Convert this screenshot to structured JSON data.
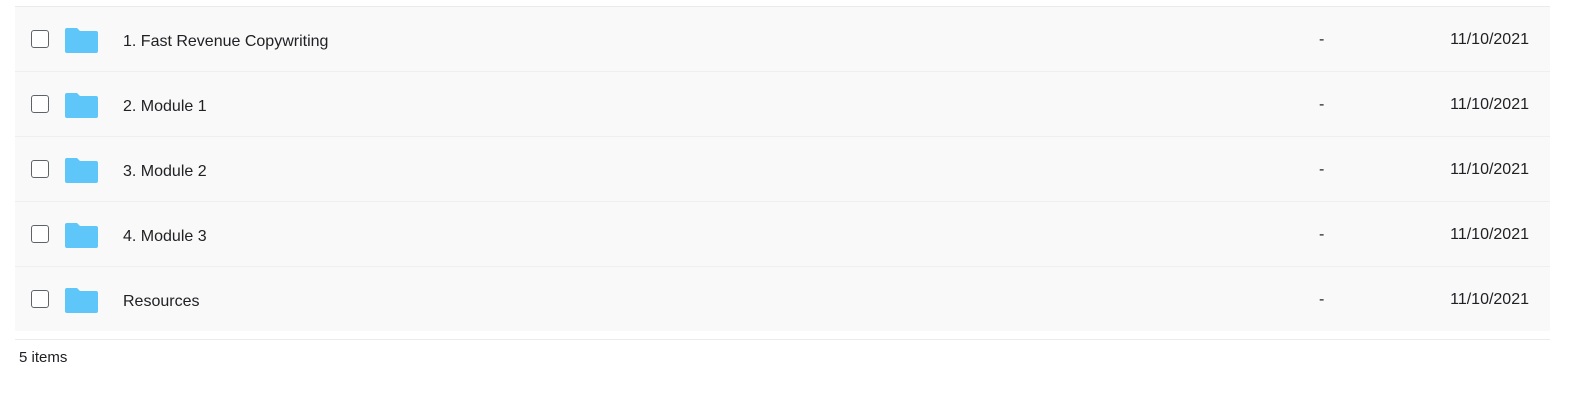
{
  "files": [
    {
      "name": "1. Fast Revenue Copywriting",
      "size": "-",
      "date": "11/10/2021",
      "icon": "folder-icon"
    },
    {
      "name": "2. Module 1",
      "size": "-",
      "date": "11/10/2021",
      "icon": "folder-icon"
    },
    {
      "name": "3. Module 2",
      "size": "-",
      "date": "11/10/2021",
      "icon": "folder-icon"
    },
    {
      "name": "4. Module 3",
      "size": "-",
      "date": "11/10/2021",
      "icon": "folder-icon"
    },
    {
      "name": "Resources",
      "size": "-",
      "date": "11/10/2021",
      "icon": "folder-icon"
    }
  ],
  "footer": {
    "item_count": "5 items"
  },
  "colors": {
    "folder": "#5ec6f9",
    "row_background": "#f9f9f9"
  }
}
